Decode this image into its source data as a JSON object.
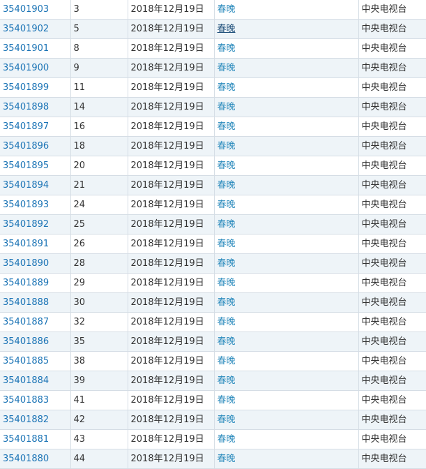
{
  "rows": [
    {
      "reg_no": "35401903",
      "class": "3",
      "date": "2018年12月19日",
      "name": "春晚",
      "applicant": "中央电视台"
    },
    {
      "reg_no": "35401902",
      "class": "5",
      "date": "2018年12月19日",
      "name": "春晚",
      "applicant": "中央电视台"
    },
    {
      "reg_no": "35401901",
      "class": "8",
      "date": "2018年12月19日",
      "name": "春晚",
      "applicant": "中央电视台"
    },
    {
      "reg_no": "35401900",
      "class": "9",
      "date": "2018年12月19日",
      "name": "春晚",
      "applicant": "中央电视台"
    },
    {
      "reg_no": "35401899",
      "class": "11",
      "date": "2018年12月19日",
      "name": "春晚",
      "applicant": "中央电视台"
    },
    {
      "reg_no": "35401898",
      "class": "14",
      "date": "2018年12月19日",
      "name": "春晚",
      "applicant": "中央电视台"
    },
    {
      "reg_no": "35401897",
      "class": "16",
      "date": "2018年12月19日",
      "name": "春晚",
      "applicant": "中央电视台"
    },
    {
      "reg_no": "35401896",
      "class": "18",
      "date": "2018年12月19日",
      "name": "春晚",
      "applicant": "中央电视台"
    },
    {
      "reg_no": "35401895",
      "class": "20",
      "date": "2018年12月19日",
      "name": "春晚",
      "applicant": "中央电视台"
    },
    {
      "reg_no": "35401894",
      "class": "21",
      "date": "2018年12月19日",
      "name": "春晚",
      "applicant": "中央电视台"
    },
    {
      "reg_no": "35401893",
      "class": "24",
      "date": "2018年12月19日",
      "name": "春晚",
      "applicant": "中央电视台"
    },
    {
      "reg_no": "35401892",
      "class": "25",
      "date": "2018年12月19日",
      "name": "春晚",
      "applicant": "中央电视台"
    },
    {
      "reg_no": "35401891",
      "class": "26",
      "date": "2018年12月19日",
      "name": "春晚",
      "applicant": "中央电视台"
    },
    {
      "reg_no": "35401890",
      "class": "28",
      "date": "2018年12月19日",
      "name": "春晚",
      "applicant": "中央电视台"
    },
    {
      "reg_no": "35401889",
      "class": "29",
      "date": "2018年12月19日",
      "name": "春晚",
      "applicant": "中央电视台"
    },
    {
      "reg_no": "35401888",
      "class": "30",
      "date": "2018年12月19日",
      "name": "春晚",
      "applicant": "中央电视台"
    },
    {
      "reg_no": "35401887",
      "class": "32",
      "date": "2018年12月19日",
      "name": "春晚",
      "applicant": "中央电视台"
    },
    {
      "reg_no": "35401886",
      "class": "35",
      "date": "2018年12月19日",
      "name": "春晚",
      "applicant": "中央电视台"
    },
    {
      "reg_no": "35401885",
      "class": "38",
      "date": "2018年12月19日",
      "name": "春晚",
      "applicant": "中央电视台"
    },
    {
      "reg_no": "35401884",
      "class": "39",
      "date": "2018年12月19日",
      "name": "春晚",
      "applicant": "中央电视台"
    },
    {
      "reg_no": "35401883",
      "class": "41",
      "date": "2018年12月19日",
      "name": "春晚",
      "applicant": "中央电视台"
    },
    {
      "reg_no": "35401882",
      "class": "42",
      "date": "2018年12月19日",
      "name": "春晚",
      "applicant": "中央电视台"
    },
    {
      "reg_no": "35401881",
      "class": "43",
      "date": "2018年12月19日",
      "name": "春晚",
      "applicant": "中央电视台"
    },
    {
      "reg_no": "35401880",
      "class": "44",
      "date": "2018年12月19日",
      "name": "春晚",
      "applicant": "中央电视台"
    }
  ],
  "colors": {
    "link": "#1a73b5",
    "name_link": "#2b8bbd",
    "row_alt": "#eef4f8",
    "border": "#d5dde5"
  }
}
